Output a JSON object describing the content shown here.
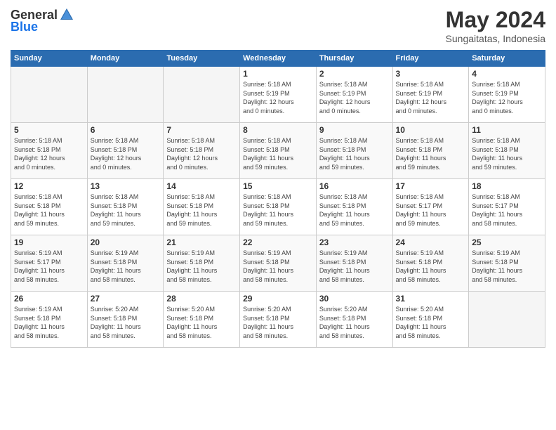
{
  "header": {
    "logo_general": "General",
    "logo_blue": "Blue",
    "month_title": "May 2024",
    "subtitle": "Sungaitatas, Indonesia"
  },
  "weekdays": [
    "Sunday",
    "Monday",
    "Tuesday",
    "Wednesday",
    "Thursday",
    "Friday",
    "Saturday"
  ],
  "weeks": [
    [
      {
        "day": "",
        "info": ""
      },
      {
        "day": "",
        "info": ""
      },
      {
        "day": "",
        "info": ""
      },
      {
        "day": "1",
        "info": "Sunrise: 5:18 AM\nSunset: 5:19 PM\nDaylight: 12 hours\nand 0 minutes."
      },
      {
        "day": "2",
        "info": "Sunrise: 5:18 AM\nSunset: 5:19 PM\nDaylight: 12 hours\nand 0 minutes."
      },
      {
        "day": "3",
        "info": "Sunrise: 5:18 AM\nSunset: 5:19 PM\nDaylight: 12 hours\nand 0 minutes."
      },
      {
        "day": "4",
        "info": "Sunrise: 5:18 AM\nSunset: 5:19 PM\nDaylight: 12 hours\nand 0 minutes."
      }
    ],
    [
      {
        "day": "5",
        "info": "Sunrise: 5:18 AM\nSunset: 5:18 PM\nDaylight: 12 hours\nand 0 minutes."
      },
      {
        "day": "6",
        "info": "Sunrise: 5:18 AM\nSunset: 5:18 PM\nDaylight: 12 hours\nand 0 minutes."
      },
      {
        "day": "7",
        "info": "Sunrise: 5:18 AM\nSunset: 5:18 PM\nDaylight: 12 hours\nand 0 minutes."
      },
      {
        "day": "8",
        "info": "Sunrise: 5:18 AM\nSunset: 5:18 PM\nDaylight: 11 hours\nand 59 minutes."
      },
      {
        "day": "9",
        "info": "Sunrise: 5:18 AM\nSunset: 5:18 PM\nDaylight: 11 hours\nand 59 minutes."
      },
      {
        "day": "10",
        "info": "Sunrise: 5:18 AM\nSunset: 5:18 PM\nDaylight: 11 hours\nand 59 minutes."
      },
      {
        "day": "11",
        "info": "Sunrise: 5:18 AM\nSunset: 5:18 PM\nDaylight: 11 hours\nand 59 minutes."
      }
    ],
    [
      {
        "day": "12",
        "info": "Sunrise: 5:18 AM\nSunset: 5:18 PM\nDaylight: 11 hours\nand 59 minutes."
      },
      {
        "day": "13",
        "info": "Sunrise: 5:18 AM\nSunset: 5:18 PM\nDaylight: 11 hours\nand 59 minutes."
      },
      {
        "day": "14",
        "info": "Sunrise: 5:18 AM\nSunset: 5:18 PM\nDaylight: 11 hours\nand 59 minutes."
      },
      {
        "day": "15",
        "info": "Sunrise: 5:18 AM\nSunset: 5:18 PM\nDaylight: 11 hours\nand 59 minutes."
      },
      {
        "day": "16",
        "info": "Sunrise: 5:18 AM\nSunset: 5:18 PM\nDaylight: 11 hours\nand 59 minutes."
      },
      {
        "day": "17",
        "info": "Sunrise: 5:18 AM\nSunset: 5:17 PM\nDaylight: 11 hours\nand 59 minutes."
      },
      {
        "day": "18",
        "info": "Sunrise: 5:18 AM\nSunset: 5:17 PM\nDaylight: 11 hours\nand 58 minutes."
      }
    ],
    [
      {
        "day": "19",
        "info": "Sunrise: 5:19 AM\nSunset: 5:17 PM\nDaylight: 11 hours\nand 58 minutes."
      },
      {
        "day": "20",
        "info": "Sunrise: 5:19 AM\nSunset: 5:18 PM\nDaylight: 11 hours\nand 58 minutes."
      },
      {
        "day": "21",
        "info": "Sunrise: 5:19 AM\nSunset: 5:18 PM\nDaylight: 11 hours\nand 58 minutes."
      },
      {
        "day": "22",
        "info": "Sunrise: 5:19 AM\nSunset: 5:18 PM\nDaylight: 11 hours\nand 58 minutes."
      },
      {
        "day": "23",
        "info": "Sunrise: 5:19 AM\nSunset: 5:18 PM\nDaylight: 11 hours\nand 58 minutes."
      },
      {
        "day": "24",
        "info": "Sunrise: 5:19 AM\nSunset: 5:18 PM\nDaylight: 11 hours\nand 58 minutes."
      },
      {
        "day": "25",
        "info": "Sunrise: 5:19 AM\nSunset: 5:18 PM\nDaylight: 11 hours\nand 58 minutes."
      }
    ],
    [
      {
        "day": "26",
        "info": "Sunrise: 5:19 AM\nSunset: 5:18 PM\nDaylight: 11 hours\nand 58 minutes."
      },
      {
        "day": "27",
        "info": "Sunrise: 5:20 AM\nSunset: 5:18 PM\nDaylight: 11 hours\nand 58 minutes."
      },
      {
        "day": "28",
        "info": "Sunrise: 5:20 AM\nSunset: 5:18 PM\nDaylight: 11 hours\nand 58 minutes."
      },
      {
        "day": "29",
        "info": "Sunrise: 5:20 AM\nSunset: 5:18 PM\nDaylight: 11 hours\nand 58 minutes."
      },
      {
        "day": "30",
        "info": "Sunrise: 5:20 AM\nSunset: 5:18 PM\nDaylight: 11 hours\nand 58 minutes."
      },
      {
        "day": "31",
        "info": "Sunrise: 5:20 AM\nSunset: 5:18 PM\nDaylight: 11 hours\nand 58 minutes."
      },
      {
        "day": "",
        "info": ""
      }
    ]
  ]
}
